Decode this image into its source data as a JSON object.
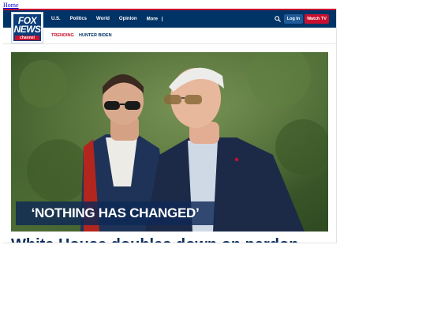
{
  "page": {
    "home_link": "Home"
  },
  "logo": {
    "line1": "FOX",
    "line2": "NEWS",
    "line3": "channel"
  },
  "nav": {
    "items": [
      "U.S.",
      "Politics",
      "World",
      "Opinion",
      "More"
    ]
  },
  "header_actions": {
    "login_label": "Log In",
    "watch_label": "Watch TV"
  },
  "trending": {
    "label": "TRENDING",
    "items": [
      "HUNTER BIDEN"
    ]
  },
  "hero": {
    "banner_text": "‘NOTHING HAS CHANGED’"
  },
  "article": {
    "headline": "White House doubles down on pardon"
  },
  "colors": {
    "brand_navy": "#003366",
    "brand_red": "#c8102e",
    "login_blue": "#1f5a99"
  }
}
